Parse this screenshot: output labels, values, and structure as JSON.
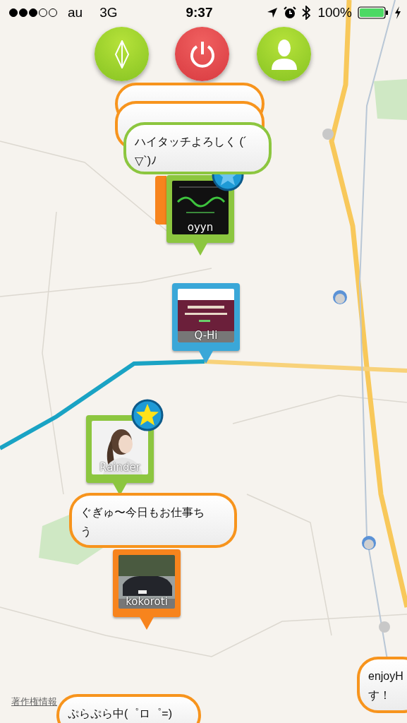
{
  "status_bar": {
    "carrier": "au",
    "network": "3G",
    "time": "9:37",
    "battery": "100%"
  },
  "bubbles": [
    {
      "color": "#f7941d"
    },
    {
      "color": "#f7941d"
    },
    {
      "color": "#8cc63f",
      "lines": [
        "ハイタッチよろしく (´",
        "▽`)ﾉ"
      ]
    },
    {
      "color": "#f7941d",
      "lines": [
        "ぐぎゅ〜今日もお仕事ち",
        "う"
      ]
    },
    {
      "color": "#f7941d",
      "lines": [
        "enjoyH",
        "す！"
      ]
    },
    {
      "color": "#f7941d",
      "lines": [
        "ぷらぷら中(゜ロ゜=)"
      ]
    }
  ],
  "pins": [
    {
      "label": "oyyn",
      "color": "#8cc63f",
      "star": {
        "color": "#6cc4f0"
      }
    },
    {
      "label": "Q-Hi",
      "color": "#3aa7d8"
    },
    {
      "label": "Rainder",
      "color": "#8cc63f",
      "star": {
        "color": "#ffe21a"
      }
    },
    {
      "label": "kokoroti",
      "color": "#f7841d"
    }
  ],
  "copyright_link": "著作権情報"
}
